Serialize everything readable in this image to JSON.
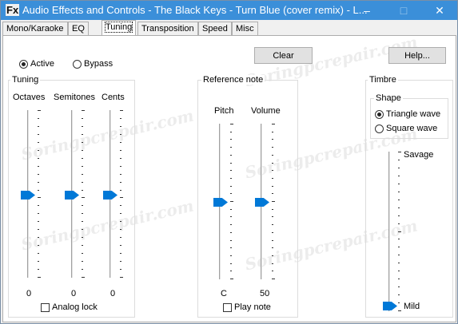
{
  "window": {
    "icon_text": "Fx",
    "title": "Audio Effects and Controls - The Black Keys - Turn Blue (cover remix) - L...",
    "minimize": "–",
    "maximize": "□",
    "close": "✕"
  },
  "tabs": [
    "Mono/Karaoke",
    "EQ",
    "Tuning",
    "Transposition",
    "Speed",
    "Misc"
  ],
  "active_tab": "Tuning",
  "buttons": {
    "clear": "Clear",
    "help": "Help..."
  },
  "mode": {
    "active": "Active",
    "bypass": "Bypass",
    "selected": "Active"
  },
  "tuning": {
    "title": "Tuning",
    "sliders": [
      {
        "label": "Octaves",
        "value": "0"
      },
      {
        "label": "Semitones",
        "value": "0"
      },
      {
        "label": "Cents",
        "value": "0"
      }
    ],
    "analog_lock": {
      "label": "Analog lock",
      "checked": false
    }
  },
  "reference": {
    "title": "Reference note",
    "sliders": [
      {
        "label": "Pitch",
        "value": "C"
      },
      {
        "label": "Volume",
        "value": "50"
      }
    ],
    "play_note": {
      "label": "Play note",
      "checked": false
    }
  },
  "timbre": {
    "title": "Timbre",
    "shape_title": "Shape",
    "shapes": [
      "Triangle wave",
      "Square wave"
    ],
    "selected_shape": "Triangle wave",
    "slider_top": "Savage",
    "slider_bottom": "Mild",
    "level": 0.0
  },
  "watermark": "Soringpcrepair.com"
}
